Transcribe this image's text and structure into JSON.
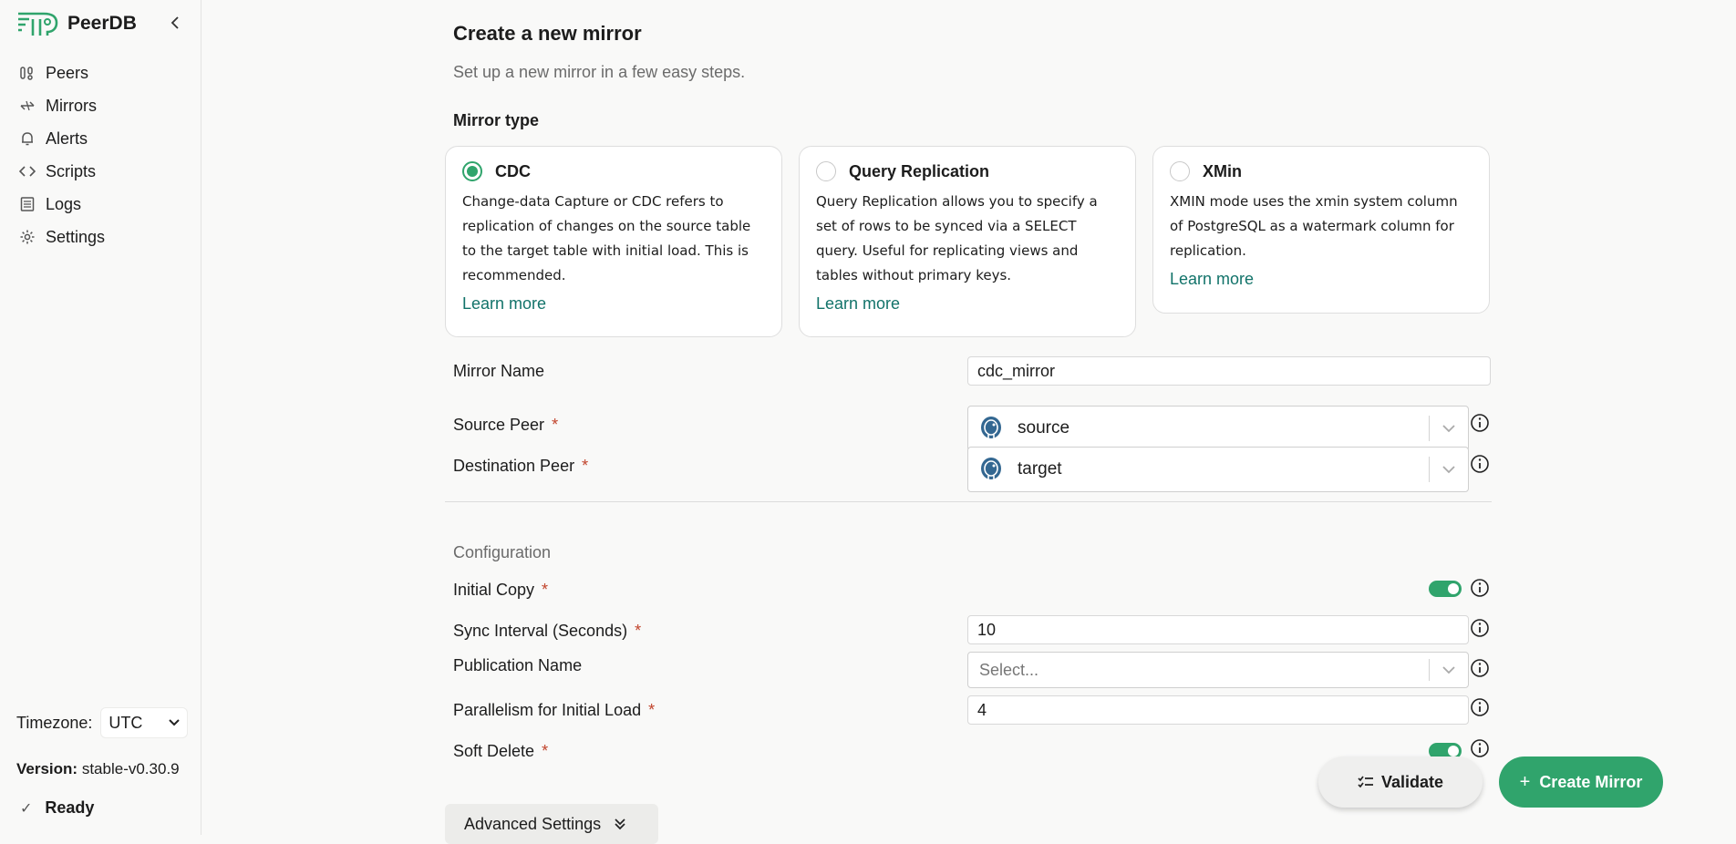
{
  "app": {
    "name": "PeerDB"
  },
  "sidebar": {
    "items": [
      {
        "label": "Peers",
        "icon": "peers-icon"
      },
      {
        "label": "Mirrors",
        "icon": "mirrors-icon"
      },
      {
        "label": "Alerts",
        "icon": "bell-icon"
      },
      {
        "label": "Scripts",
        "icon": "code-icon"
      },
      {
        "label": "Logs",
        "icon": "logs-icon"
      },
      {
        "label": "Settings",
        "icon": "gear-icon"
      }
    ],
    "timezone_label": "Timezone:",
    "timezone_value": "UTC",
    "version_label": "Version:",
    "version_value": "stable-v0.30.9",
    "status": "Ready"
  },
  "page": {
    "title": "Create a new mirror",
    "subtitle": "Set up a new mirror in a few easy steps.",
    "mirror_type_heading": "Mirror type"
  },
  "mirror_types": [
    {
      "name": "CDC",
      "selected": true,
      "desc": "Change-data Capture or CDC refers to replication of changes on the source table to the target table with initial load. This is recommended.",
      "learn": "Learn more"
    },
    {
      "name": "Query Replication",
      "selected": false,
      "desc": "Query Replication allows you to specify a set of rows to be synced via a SELECT query. Useful for replicating views and tables without primary keys.",
      "learn": "Learn more"
    },
    {
      "name": "XMin",
      "selected": false,
      "desc": "XMIN mode uses the xmin system column of PostgreSQL as a watermark column for replication.",
      "learn": "Learn more"
    }
  ],
  "form": {
    "mirror_name_label": "Mirror Name",
    "mirror_name_value": "cdc_mirror",
    "source_peer_label": "Source Peer",
    "source_peer_value": "source",
    "destination_peer_label": "Destination Peer",
    "destination_peer_value": "target",
    "required_mark": "*"
  },
  "config": {
    "heading": "Configuration",
    "initial_copy_label": "Initial Copy",
    "initial_copy_on": true,
    "sync_interval_label": "Sync Interval (Seconds)",
    "sync_interval_value": "10",
    "publication_label": "Publication Name",
    "publication_placeholder": "Select...",
    "parallelism_label": "Parallelism for Initial Load",
    "parallelism_value": "4",
    "soft_delete_label": "Soft Delete",
    "soft_delete_on": true
  },
  "actions": {
    "validate": "Validate",
    "create": "Create Mirror",
    "advanced": "Advanced Settings"
  },
  "colors": {
    "accent": "#30a46c",
    "link": "#12736a",
    "required": "#c1432b"
  }
}
